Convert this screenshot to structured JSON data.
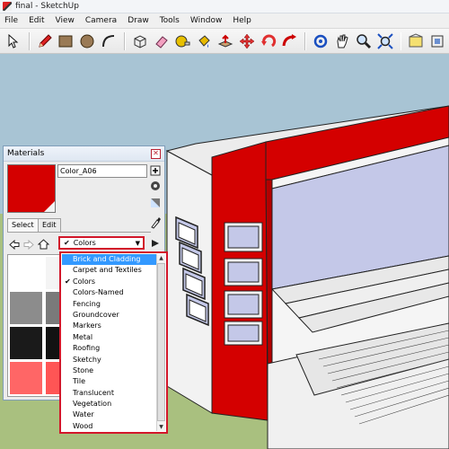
{
  "window": {
    "title": "final - SketchUp"
  },
  "menu": [
    "File",
    "Edit",
    "View",
    "Camera",
    "Draw",
    "Tools",
    "Window",
    "Help"
  ],
  "toolbar": {
    "icons": [
      "select-icon",
      "pencil-icon",
      "rectangle-icon",
      "circle-icon",
      "arc-icon",
      "make-component-icon",
      "eraser-icon",
      "tape-measure-icon",
      "paint-bucket-icon",
      "push-pull-icon",
      "move-icon",
      "rotate-icon",
      "follow-me-icon",
      "orbit-icon",
      "pan-icon",
      "zoom-icon",
      "zoom-extents-icon",
      "3d-warehouse-icon",
      "components-icon"
    ]
  },
  "materials_panel": {
    "title": "Materials",
    "material_name": "Color_A06",
    "preview_color": "#d40000",
    "tabs": [
      "Select",
      "Edit"
    ],
    "collection": "Colors",
    "swatches": [
      "#ffffff",
      "#f4f4f4",
      "#8c8c8c",
      "#7a7a7a",
      "#1a1a1a",
      "#121212",
      "#ff6666",
      "#ff5555"
    ]
  },
  "dropdown": {
    "items": [
      {
        "label": "Brick and Cladding",
        "selected": true,
        "checked": false
      },
      {
        "label": "Carpet and Textiles",
        "selected": false,
        "checked": false
      },
      {
        "label": "Colors",
        "selected": false,
        "checked": true
      },
      {
        "label": "Colors-Named",
        "selected": false,
        "checked": false
      },
      {
        "label": "Fencing",
        "selected": false,
        "checked": false
      },
      {
        "label": "Groundcover",
        "selected": false,
        "checked": false
      },
      {
        "label": "Markers",
        "selected": false,
        "checked": false
      },
      {
        "label": "Metal",
        "selected": false,
        "checked": false
      },
      {
        "label": "Roofing",
        "selected": false,
        "checked": false
      },
      {
        "label": "Sketchy",
        "selected": false,
        "checked": false
      },
      {
        "label": "Stone",
        "selected": false,
        "checked": false
      },
      {
        "label": "Tile",
        "selected": false,
        "checked": false
      },
      {
        "label": "Translucent",
        "selected": false,
        "checked": false
      },
      {
        "label": "Vegetation",
        "selected": false,
        "checked": false
      },
      {
        "label": "Water",
        "selected": false,
        "checked": false
      },
      {
        "label": "Wood",
        "selected": false,
        "checked": false
      }
    ]
  },
  "colors": {
    "ground": "#a9c07f",
    "accent_red": "#d40000",
    "highlight": "#3399ff"
  }
}
